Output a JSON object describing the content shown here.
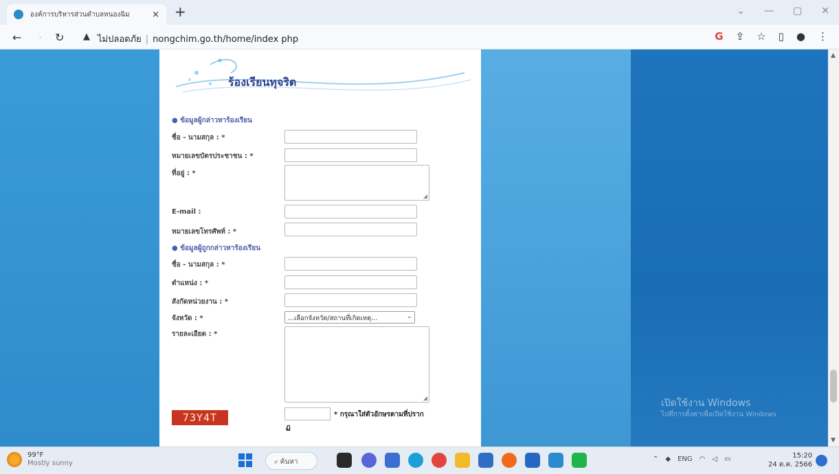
{
  "browser": {
    "tab_title": "องค์การบริหารส่วนตำบลหนองฉิม",
    "tab_close": "×",
    "new_tab": "+",
    "security_label": "ไม่ปลอดภัย",
    "url": "nongchim.go.th/home/index php"
  },
  "page": {
    "banner_title": "ร้องเรียนทุจริต",
    "section_complainant": "ข้อมูลผู้กล่าวหาร้องเรียน",
    "section_accused": "ข้อมูลผู้ถูกกล่าวหาร้องเรียน",
    "labels": {
      "name": "ชื่อ - นามสกุล : *",
      "id_card": "หมายเลขบัตรประชาชน : *",
      "address": "ที่อยู่ : *",
      "email": "E-mail :",
      "phone": "หมายเลขโทรศัพท์ : *",
      "accused_name": "ชื่อ - นามสกุล : *",
      "position": "ตำแหน่ง : *",
      "agency": "สังกัดหน่วยงาน : *",
      "province": "จังหวัด : *",
      "details": "รายละเอียด : *"
    },
    "province_selected": "...เลือกจังหวัด/สถานที่เกิดเหตุ...",
    "captcha_code": "73Y4T",
    "captcha_note": "* กรุณาใส่ตัวอักษรตามที่ปราก",
    "captcha_note_wrap": "ฏ"
  },
  "watermark": {
    "title": "เปิดใช้งาน Windows",
    "subtitle": "ไปที่การตั้งค่าเพื่อเปิดใช้งาน Windows"
  },
  "taskbar": {
    "weather_temp": "99°F",
    "weather_desc": "Mostly sunny",
    "search_label": "ค้นหา",
    "language": "ENG",
    "time": "15:20",
    "date": "24 ต.ค. 2566"
  },
  "colors": {
    "accent_blue": "#2f8fd0",
    "captcha_bg": "#c8351f",
    "section_heading": "#4a5fa8"
  }
}
